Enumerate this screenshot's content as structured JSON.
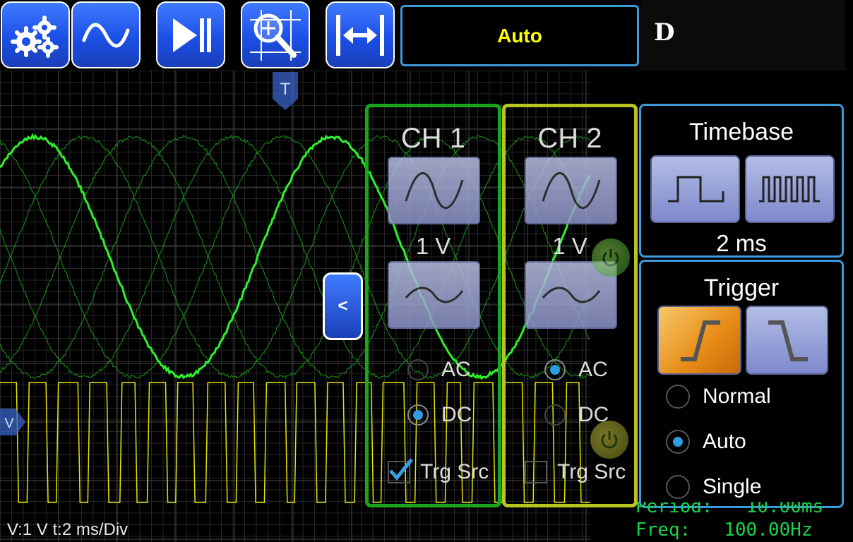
{
  "toolbar": {
    "buttons": [
      {
        "name": "settings-button",
        "icon": "gear-icon"
      },
      {
        "name": "waveform-button",
        "icon": "sine-wave-icon"
      },
      {
        "name": "play-pause-button",
        "icon": "play-pause-icon"
      },
      {
        "name": "measure-zoom-button",
        "icon": "crosshair-magnifier-icon"
      },
      {
        "name": "fit-width-button",
        "icon": "fit-width-icon"
      }
    ],
    "mode_label": "Auto",
    "logo_letter": "D"
  },
  "scope": {
    "trigger_marker": "T",
    "level_marker": "V",
    "bottom_info": "V:1 V   t:2 ms/Div",
    "panel_toggle": "<"
  },
  "channels": [
    {
      "title": "CH 1",
      "volts": "1 V",
      "ac_label": "AC",
      "dc_label": "DC",
      "coupling": "DC",
      "trg_label": "Trg Src",
      "trg_checked": true,
      "color": "#19a51c"
    },
    {
      "title": "CH 2",
      "volts": "1 V",
      "ac_label": "AC",
      "dc_label": "DC",
      "coupling": "AC",
      "trg_label": "Trg Src",
      "trg_checked": false,
      "color": "#b9c422"
    }
  ],
  "timebase": {
    "title": "Timebase",
    "value": "2 ms"
  },
  "trigger": {
    "title": "Trigger",
    "modes": [
      "Normal",
      "Auto",
      "Single"
    ],
    "selected": "Auto",
    "edge": "rising"
  },
  "measurements": {
    "period_label": "Period:",
    "period_value": "10.00ms",
    "freq_label": "Freq:",
    "freq_value": "100.00Hz"
  },
  "colors": {
    "accent": "#3c9ad8",
    "ch1": "#19a51c",
    "ch2": "#b9c422",
    "trace": "#2cf22c",
    "square": "#e6e600",
    "readout": "#19d24a"
  }
}
